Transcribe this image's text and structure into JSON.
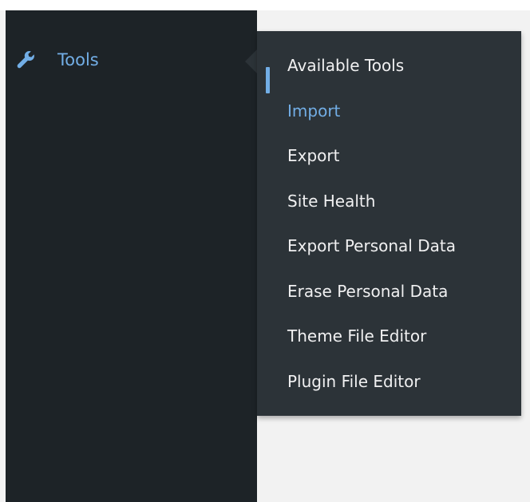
{
  "sidebar": {
    "menu": {
      "icon": "wrench-icon",
      "label": "Tools"
    }
  },
  "submenu": {
    "items": [
      {
        "label": "Available Tools",
        "current": false
      },
      {
        "label": "Import",
        "current": true
      },
      {
        "label": "Export",
        "current": false
      },
      {
        "label": "Site Health",
        "current": false
      },
      {
        "label": "Export Personal Data",
        "current": false
      },
      {
        "label": "Erase Personal Data",
        "current": false
      },
      {
        "label": "Theme File Editor",
        "current": false
      },
      {
        "label": "Plugin File Editor",
        "current": false
      }
    ]
  },
  "colors": {
    "sidebar_bg": "#1d2327",
    "submenu_bg": "#2c3338",
    "accent": "#72aee6",
    "text": "#f0f0f1"
  }
}
